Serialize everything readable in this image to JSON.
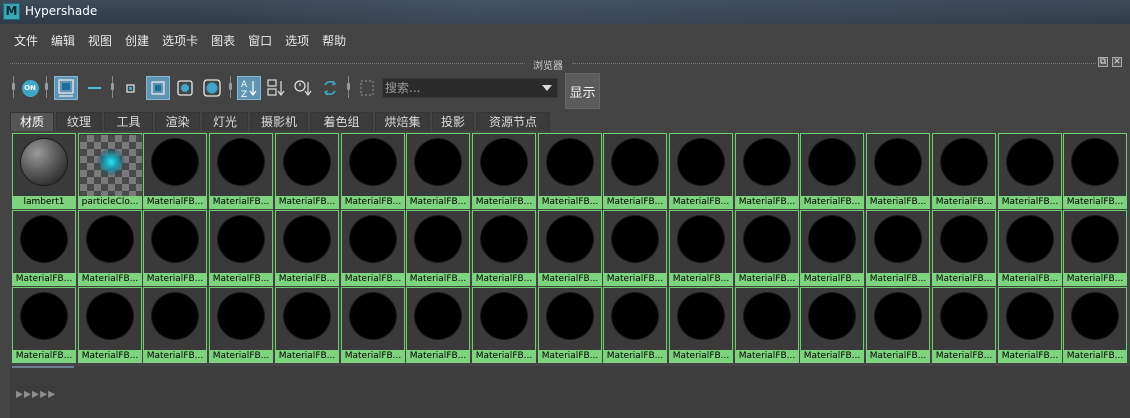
{
  "window": {
    "title": "Hypershade",
    "app_icon_letter": "M"
  },
  "menu": [
    "文件",
    "编辑",
    "视图",
    "创建",
    "选项卡",
    "图表",
    "窗口",
    "选项",
    "帮助"
  ],
  "browser": {
    "panel_title": "浏览器"
  },
  "toolbar": {
    "on_label": "ON",
    "search_placeholder": "搜索...",
    "show_label": "显示",
    "sort_az_label": "AZ"
  },
  "tabs": [
    {
      "label": "材质",
      "active": true
    },
    {
      "label": "纹理",
      "active": false
    },
    {
      "label": "工具",
      "active": false
    },
    {
      "label": "渲染",
      "active": false
    },
    {
      "label": "灯光",
      "active": false
    },
    {
      "label": "摄影机",
      "active": false
    },
    {
      "label": "着色组",
      "active": false
    },
    {
      "label": "烘焙集",
      "active": false
    },
    {
      "label": "投影",
      "active": false
    },
    {
      "label": "资源节点",
      "active": false
    }
  ],
  "swatches": {
    "rows": [
      [
        "lambert1",
        "particleClo...",
        "MaterialFB...",
        "MaterialFB...",
        "MaterialFB...",
        "MaterialFB...",
        "MaterialFB...",
        "MaterialFB...",
        "MaterialFB...",
        "MaterialFB...",
        "MaterialFB...",
        "MaterialFB...",
        "MaterialFB...",
        "MaterialFB...",
        "MaterialFB...",
        "MaterialFB...",
        "MaterialFB..."
      ],
      [
        "MaterialFB...",
        "MaterialFB...",
        "MaterialFB...",
        "MaterialFB...",
        "MaterialFB...",
        "MaterialFB...",
        "MaterialFB...",
        "MaterialFB...",
        "MaterialFB...",
        "MaterialFB...",
        "MaterialFB...",
        "MaterialFB...",
        "MaterialFB...",
        "MaterialFB...",
        "MaterialFB...",
        "MaterialFB...",
        "MaterialFB..."
      ],
      [
        "MaterialFB...",
        "MaterialFB...",
        "MaterialFB...",
        "MaterialFB...",
        "MaterialFB...",
        "MaterialFB...",
        "MaterialFB...",
        "MaterialFB...",
        "MaterialFB...",
        "MaterialFB...",
        "MaterialFB...",
        "MaterialFB...",
        "MaterialFB...",
        "MaterialFB...",
        "MaterialFB...",
        "MaterialFB...",
        "MaterialFB..."
      ]
    ],
    "preview_kinds": {
      "lambert1": "gray-sphere",
      "particleClo...": "checker-cyan-glow",
      "default": "black-sphere"
    }
  },
  "bottom": {
    "arrows": "▸▸▸▸▸"
  },
  "colors": {
    "selection_green": "#7ed47e",
    "active_button_blue": "#5f94b3",
    "background": "#444444"
  }
}
